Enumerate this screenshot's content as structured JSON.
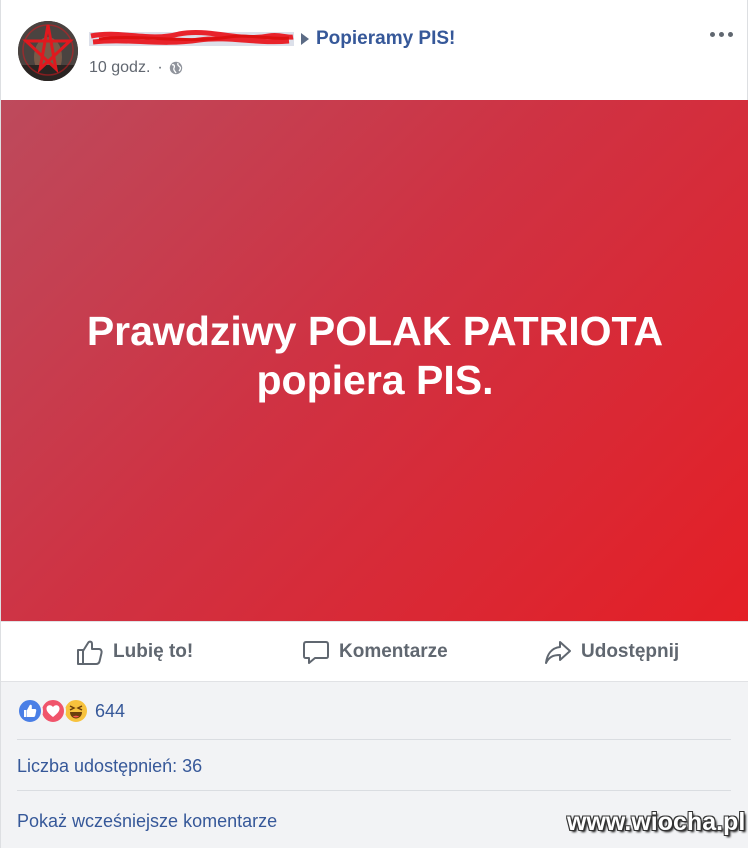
{
  "header": {
    "author_name": "",
    "group_name": "Popieramy PIS!",
    "time": "10 godz.",
    "separator": "·",
    "privacy_icon": "globe-icon",
    "more_icon": "more-options-icon"
  },
  "post": {
    "text_line1": "Prawdziwy POLAK PATRIOTA",
    "text_line2": "popiera PIS.",
    "gradient_start": "#bd4a5c",
    "gradient_end": "#e41f26"
  },
  "actions": {
    "like_label": "Lubię to!",
    "comment_label": "Komentarze",
    "share_label": "Udostępnij"
  },
  "reactions": {
    "icons": [
      "like-reaction-icon",
      "love-reaction-icon",
      "haha-reaction-icon"
    ],
    "count": "644"
  },
  "shares": {
    "label": "Liczba udostępnień: 36"
  },
  "comments": {
    "show_earlier_label": "Pokaż wcześniejsze komentarze"
  },
  "watermark": "www.wiocha.pl",
  "colors": {
    "link": "#365899",
    "action_text": "#606770",
    "footer_bg": "#f2f3f5"
  }
}
